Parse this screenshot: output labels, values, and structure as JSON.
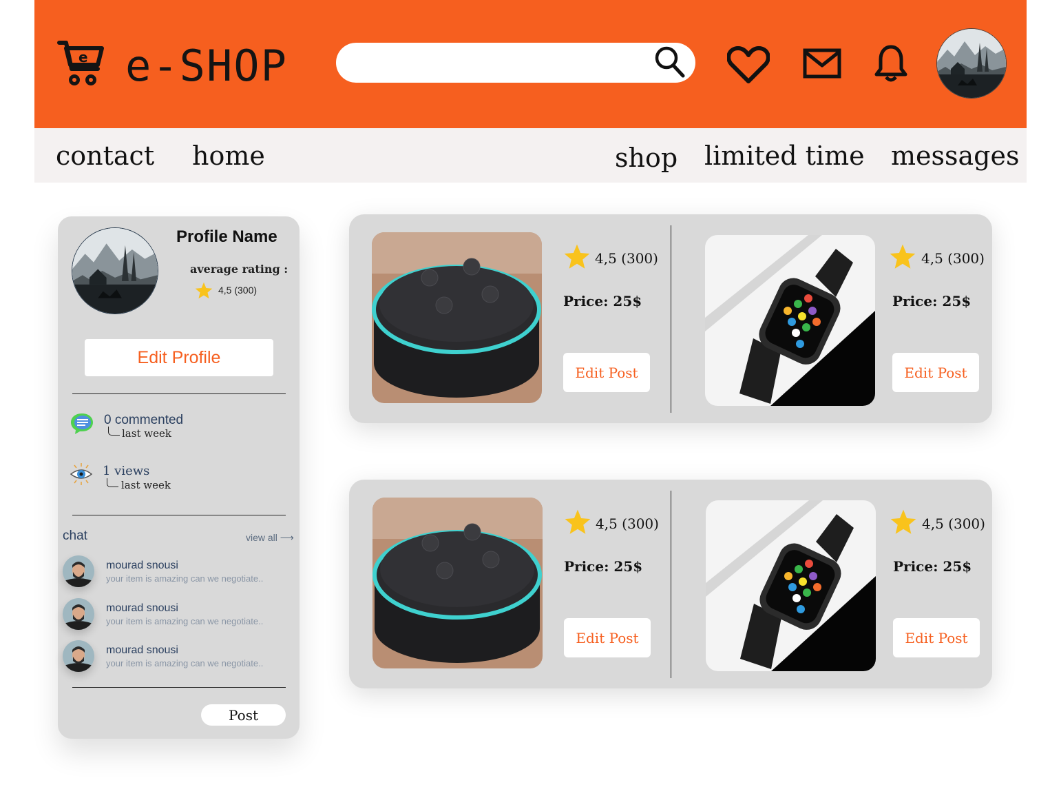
{
  "brand": {
    "name": "e-SHOP",
    "accent": "#f65f1f"
  },
  "search": {
    "placeholder": "",
    "value": ""
  },
  "header_icons": [
    "search-icon",
    "heart-icon",
    "mail-icon",
    "bell-icon",
    "avatar"
  ],
  "nav": {
    "contact": "contact",
    "home": "home",
    "shop": "shop",
    "limited_time": "limited time",
    "messages": "messages"
  },
  "profile": {
    "name": "Profile Name",
    "average_rating_label": "average rating :",
    "rating": "4,5 (300)",
    "edit_label": "Edit Profile"
  },
  "stats": [
    {
      "icon": "comment-icon",
      "main": "0 commented",
      "sub": "last week"
    },
    {
      "icon": "eye-icon",
      "main": "1 views",
      "sub": "last week"
    }
  ],
  "chat": {
    "title": "chat",
    "view_all": "view all ⟶",
    "messages": [
      {
        "name": "mourad snousi",
        "text": "your item is amazing can we negotiate.."
      },
      {
        "name": "mourad snousi",
        "text": "your item is amazing can we negotiate.."
      },
      {
        "name": "mourad snousi",
        "text": "your item is amazing can we negotiate.."
      }
    ]
  },
  "post_label": "Post",
  "products": [
    {
      "image": "smart-speaker",
      "rating": "4,5 (300)",
      "price": "Price:  25$",
      "action": "Edit Post"
    },
    {
      "image": "smart-watch",
      "rating": "4,5 (300)",
      "price": "Price:  25$",
      "action": "Edit Post"
    },
    {
      "image": "smart-speaker",
      "rating": "4,5 (300)",
      "price": "Price:  25$",
      "action": "Edit Post"
    },
    {
      "image": "smart-watch",
      "rating": "4,5 (300)",
      "price": "Price:  25$",
      "action": "Edit Post"
    }
  ]
}
